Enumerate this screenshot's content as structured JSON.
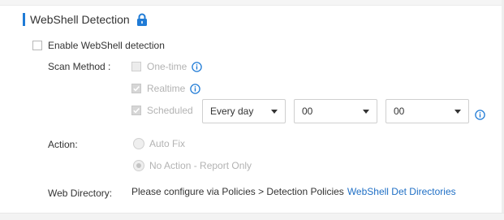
{
  "section": {
    "title": "WebShell Detection",
    "lock_icon": "lock-icon",
    "accent_color": "#1f7bd6"
  },
  "enable": {
    "label": "Enable WebShell detection",
    "checked": false
  },
  "scan_method": {
    "label": "Scan Method :",
    "options": [
      {
        "label": "One-time",
        "checked": false,
        "disabled": true,
        "info_icon": "info-icon"
      },
      {
        "label": "Realtime",
        "checked": true,
        "disabled": true,
        "info_icon": "info-icon"
      },
      {
        "label": "Scheduled",
        "checked": true,
        "disabled": true
      }
    ],
    "schedule": {
      "frequency": "Every day",
      "hour": "00",
      "minute": "00",
      "info_icon": "info-icon"
    }
  },
  "action": {
    "label": "Action:",
    "options": [
      {
        "label": "Auto Fix",
        "selected": false,
        "disabled": true
      },
      {
        "label": "No Action - Report Only",
        "selected": true,
        "disabled": true
      }
    ]
  },
  "web_directory": {
    "label": "Web Directory:",
    "text": "Please configure via Policies > Detection Policies",
    "link_text": "WebShell Det Directories",
    "link_color": "#1f6fc5"
  }
}
